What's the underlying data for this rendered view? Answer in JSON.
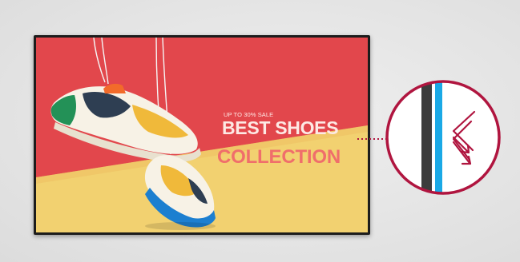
{
  "promo": {
    "sale_line": "UP TO 30% SALE",
    "headline": "BEST SHOES",
    "subline": "COLLECTION"
  },
  "colors": {
    "background": "#e6e6e6",
    "bezel": "#1c1c1c",
    "wall_red": "#e2474c",
    "floor_yellow": "#f2d170",
    "headline_text": "#fde9e4",
    "subline_text": "#f06e6b",
    "callout_ring": "#b0153f",
    "glass_blue": "#1aa9e6"
  },
  "icons": {
    "callout": "zoom-magnifier-icon",
    "arrows": "light-refraction-arrows-icon"
  }
}
